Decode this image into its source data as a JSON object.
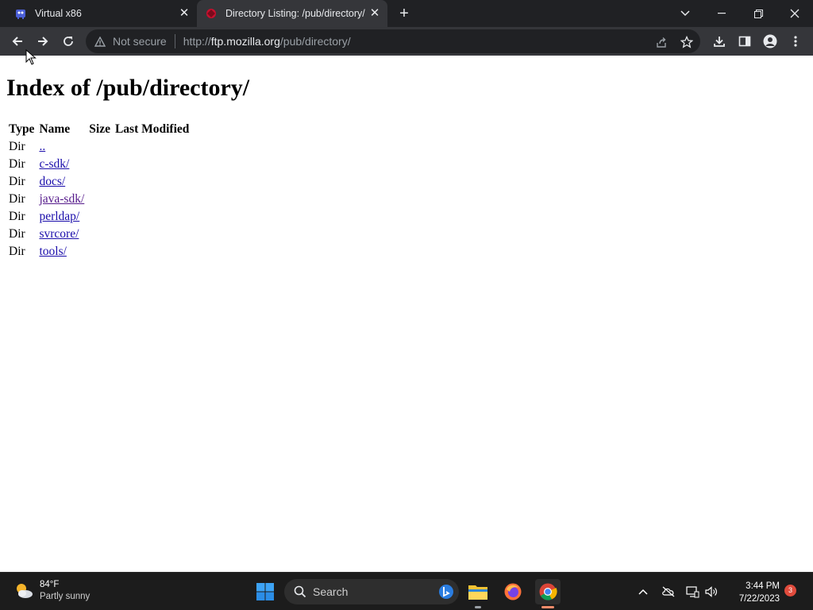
{
  "browser": {
    "tabs": [
      {
        "title": "Virtual x86",
        "active": false
      },
      {
        "title": "Directory Listing: /pub/directory/",
        "active": true
      }
    ],
    "omnibox": {
      "security_label": "Not secure",
      "url_scheme": "http://",
      "url_host": "ftp.mozilla.org",
      "url_path": "/pub/directory/"
    }
  },
  "page": {
    "heading": "Index of /pub/directory/",
    "table": {
      "headers": [
        "Type",
        "Name",
        "Size",
        "Last Modified"
      ],
      "rows": [
        {
          "type": "Dir",
          "name": ".."
        },
        {
          "type": "Dir",
          "name": "c-sdk/"
        },
        {
          "type": "Dir",
          "name": "docs/"
        },
        {
          "type": "Dir",
          "name": "java-sdk/"
        },
        {
          "type": "Dir",
          "name": "perldap/"
        },
        {
          "type": "Dir",
          "name": "svrcore/"
        },
        {
          "type": "Dir",
          "name": "tools/"
        }
      ]
    }
  },
  "taskbar": {
    "weather": {
      "temp": "84°F",
      "condition": "Partly sunny"
    },
    "search_label": "Search",
    "clock": {
      "time": "3:44 PM",
      "date": "7/22/2023"
    },
    "notification_count": "3"
  },
  "colors": {
    "link": "#1a0dab",
    "visited_link": "#551a8b",
    "chrome_dark": "#202124",
    "toolbar": "#35363a",
    "taskbar": "#1c1c1c"
  }
}
